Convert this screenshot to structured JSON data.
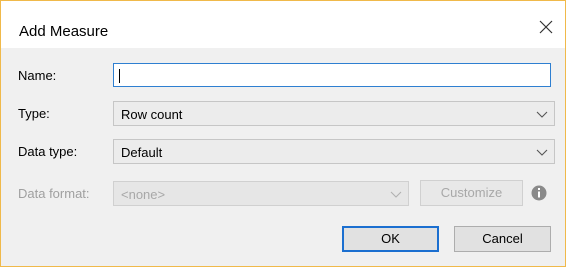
{
  "dialog": {
    "title": "Add Measure"
  },
  "form": {
    "name_label": "Name:",
    "name_value": "",
    "type_label": "Type:",
    "type_value": "Row count",
    "datatype_label": "Data type:",
    "datatype_value": "Default",
    "dataformat_label": "Data format:",
    "dataformat_value": "<none>"
  },
  "buttons": {
    "customize": "Customize",
    "ok": "OK",
    "cancel": "Cancel"
  },
  "icons": {
    "close": "close-icon",
    "chevron": "chevron-down-icon",
    "info": "info-icon"
  },
  "colors": {
    "accent": "#2e7fd1",
    "window_border": "#f0b94a",
    "disabled_text": "#a8a8a8"
  }
}
